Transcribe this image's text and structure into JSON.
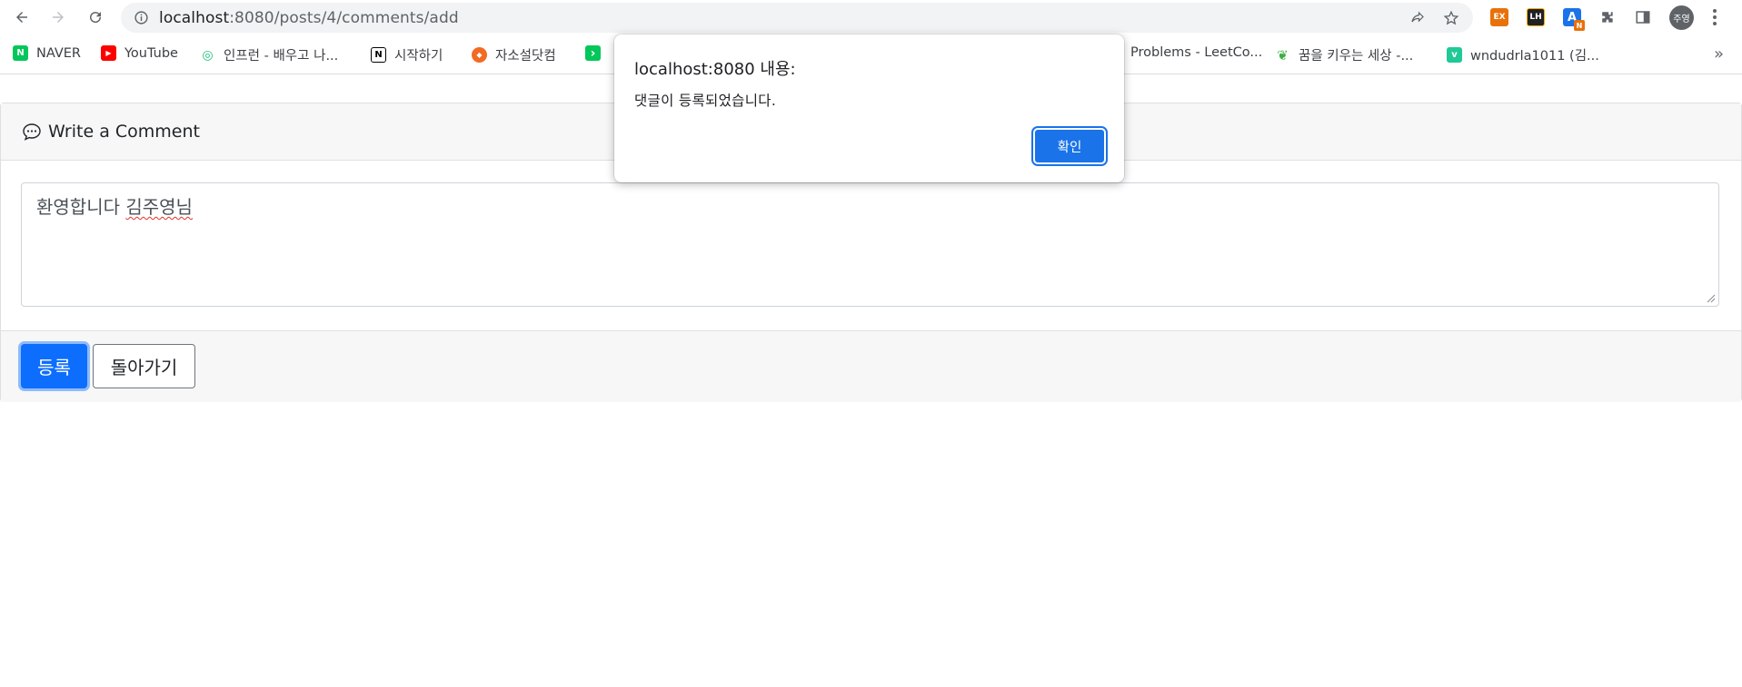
{
  "browser": {
    "url_host": "localhost",
    "url_rest": ":8080/posts/4/comments/add",
    "profile_initials": "주영",
    "extensions": [
      {
        "name": "ex-extension",
        "label": "EX",
        "color": "#e8710a"
      },
      {
        "name": "lh-extension",
        "label": "LH",
        "color": "#202124"
      },
      {
        "name": "translate-extension",
        "label": "A",
        "badge": "N",
        "color": "#1a73e8"
      }
    ]
  },
  "bookmarks": [
    {
      "label": "NAVER",
      "icon": "N",
      "color": "#03c75a"
    },
    {
      "label": "YouTube",
      "icon": "▶",
      "color": "#ff0000"
    },
    {
      "label": "인프런 - 배우고 나...",
      "icon": "◎",
      "color": "#1dc078"
    },
    {
      "label": "시작하기",
      "icon": "N",
      "color": "#000000"
    },
    {
      "label": "자소설닷컴",
      "icon": "◆",
      "color": "#f26b21"
    },
    {
      "label": "",
      "icon": "›",
      "color": "#03c75a"
    },
    {
      "label": "Problems - LeetCo...",
      "icon": "",
      "color": ""
    },
    {
      "label": "꿈을 키우는 세상 -...",
      "icon": "❦",
      "color": "#3cb043"
    },
    {
      "label": "wndudrla1011 (김...",
      "icon": "v",
      "color": "#20c997"
    }
  ],
  "page": {
    "header_title": "Write a Comment",
    "comment_prefix": "환영합니다 ",
    "comment_misspelled": "김주영님",
    "submit_label": "등록",
    "back_label": "돌아가기"
  },
  "dialog": {
    "title": "localhost:8080 내용:",
    "message": "댓글이 등록되었습니다.",
    "ok_label": "확인"
  },
  "colors": {
    "primary": "#0d6efd",
    "dialog_button": "#1a73e8",
    "header_bg": "#f7f7f7"
  }
}
